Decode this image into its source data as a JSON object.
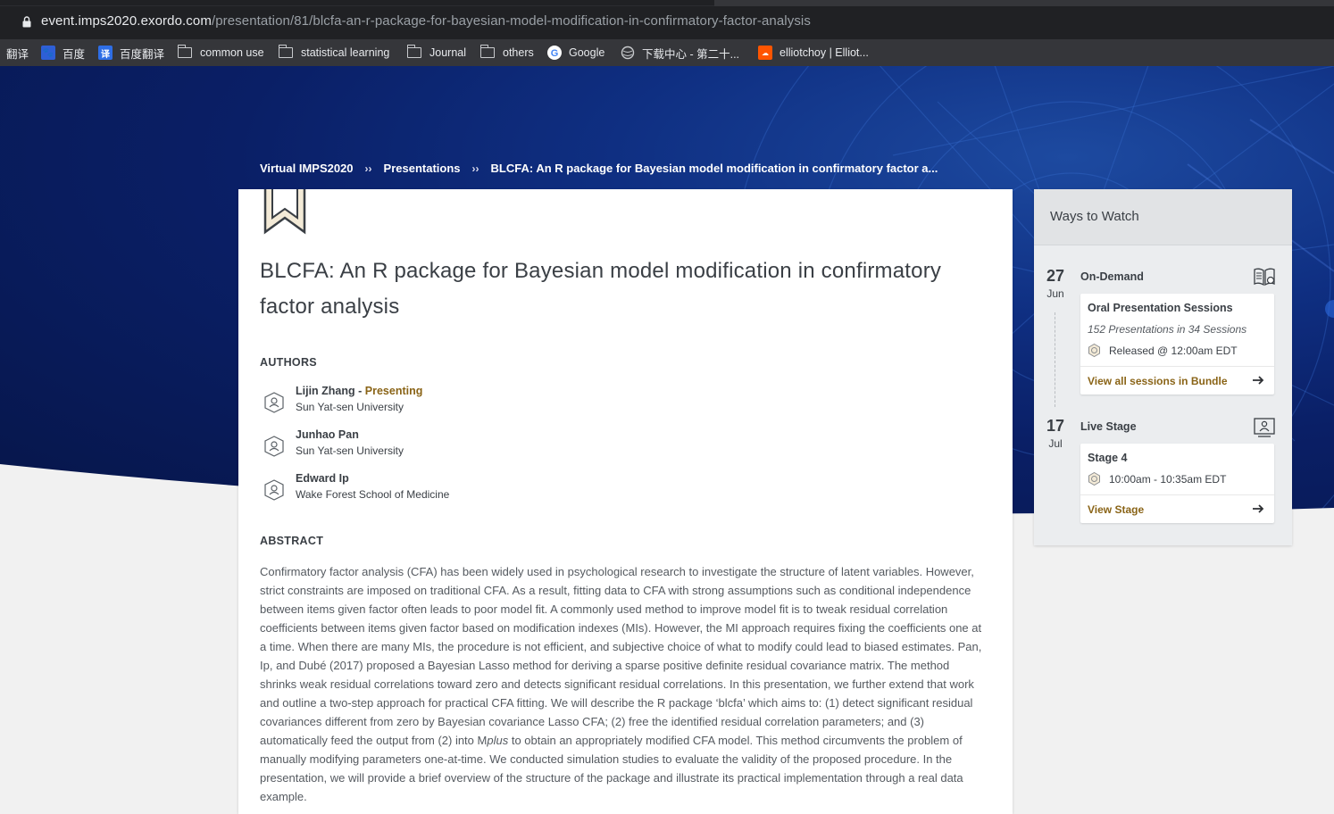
{
  "browser": {
    "url_host": "event.imps2020.exordo.com",
    "url_path": "/presentation/81/blcfa-an-r-package-for-bayesian-model-modification-in-confirmatory-factor-analysis",
    "bookmarks": [
      {
        "label": "翻译",
        "icon": "translate-icon"
      },
      {
        "label": "百度",
        "icon": "baidu-paw-icon"
      },
      {
        "label": "百度翻译",
        "icon": "baidu-translate-icon"
      },
      {
        "label": "common use",
        "icon": "folder-icon"
      },
      {
        "label": "statistical learning",
        "icon": "folder-icon"
      },
      {
        "label": "Journal",
        "icon": "folder-icon"
      },
      {
        "label": "others",
        "icon": "folder-icon"
      },
      {
        "label": "Google",
        "icon": "google-icon"
      },
      {
        "label": "下载中心 - 第二十...",
        "icon": "globe-icon"
      },
      {
        "label": "elliotchoy | Elliot...",
        "icon": "soundcloud-icon"
      }
    ]
  },
  "breadcrumb": {
    "items": [
      "Virtual IMPS2020",
      "Presentations",
      "BLCFA: An R package for Bayesian model modification in confirmatory factor a..."
    ],
    "separator": "››"
  },
  "presentation": {
    "title": "BLCFA: An R package for Bayesian model modification in confirmatory factor analysis",
    "authors_heading": "AUTHORS",
    "authors": [
      {
        "name": "Lijin Zhang",
        "presenting_label": "Presenting",
        "affiliation": "Sun Yat-sen University"
      },
      {
        "name": "Junhao Pan",
        "affiliation": "Sun Yat-sen University"
      },
      {
        "name": "Edward Ip",
        "affiliation": "Wake Forest School of Medicine"
      }
    ],
    "abstract_heading": "ABSTRACT",
    "abstract_before_italic": "Confirmatory factor analysis (CFA) has been widely used in psychological research to investigate the structure of latent variables. However, strict constraints are imposed on traditional CFA. As a result, fitting data to CFA with strong assumptions such as conditional independence between items given factor often leads to poor model fit. A commonly used method to improve model fit is to tweak residual correlation coefficients between items given factor based on modification indexes (MIs). However, the MI approach requires fixing the coefficients one at a time. When there are many MIs, the procedure is not efficient, and subjective choice of what to modify could lead to biased estimates. Pan, Ip, and Dubé (2017) proposed a Bayesian Lasso method for deriving a sparse positive definite residual covariance matrix. The method shrinks weak residual correlations toward zero and detects significant residual correlations. In this presentation, we further extend that work and outline a two-step approach for practical CFA fitting. We will describe the R package ‘blcfa’ which aims to: (1) detect significant residual covariances different from zero by Bayesian covariance Lasso CFA; (2) free the identified residual correlation parameters; and (3) automatically feed the output from (2) into M",
    "abstract_italic": "plus",
    "abstract_after_italic": " to obtain an appropriately modified CFA model. This method circumvents the problem of manually modifying parameters one-at-time. We conducted simulation studies to evaluate the validity of the proposed procedure. In the presentation, we will provide a brief overview of the structure of the package and illustrate its practical implementation through a real data example."
  },
  "ways_to_watch": {
    "heading": "Ways to Watch",
    "entries": [
      {
        "day": "27",
        "month": "Jun",
        "type": "On-Demand",
        "icon": "book-icon",
        "card_title": "Oral Presentation Sessions",
        "card_subtitle": "152 Presentations in 34 Sessions",
        "time": "Released @ 12:00am EDT",
        "link": "View all sessions in Bundle"
      },
      {
        "day": "17",
        "month": "Jul",
        "type": "Live Stage",
        "icon": "presenter-icon",
        "card_title": "Stage 4",
        "time": "10:00am - 10:35am EDT",
        "link": "View Stage"
      }
    ]
  },
  "colors": {
    "accent": "#8a6417",
    "hero": "#0a1f66",
    "text": "#3a3f45"
  }
}
